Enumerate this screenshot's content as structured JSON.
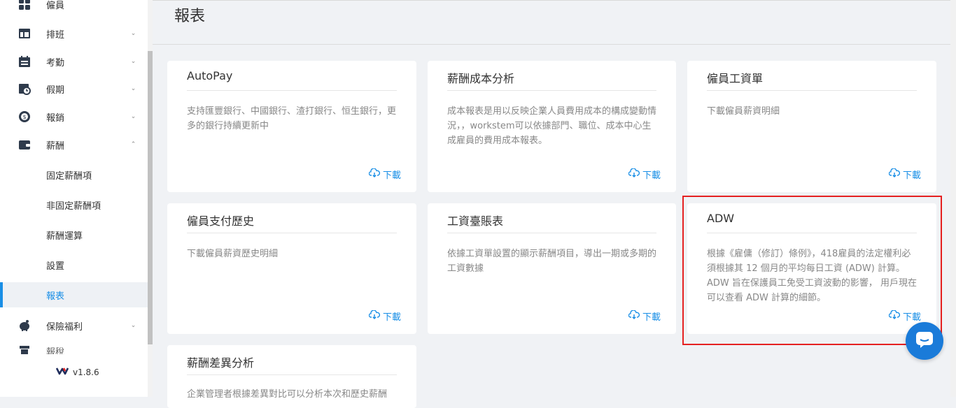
{
  "sidebar": {
    "items": [
      {
        "label": "僱員",
        "icon": "grid-icon",
        "chevron": ""
      },
      {
        "label": "排班",
        "icon": "layout-icon",
        "chevron": "⌄"
      },
      {
        "label": "考勤",
        "icon": "calendar-icon",
        "chevron": "⌄"
      },
      {
        "label": "假期",
        "icon": "calendar-clock-icon",
        "chevron": "⌄"
      },
      {
        "label": "報銷",
        "icon": "coin-icon",
        "chevron": "⌄"
      },
      {
        "label": "薪酬",
        "icon": "wallet-icon",
        "chevron": "⌃"
      }
    ],
    "sub_items": [
      {
        "label": "固定薪酬項"
      },
      {
        "label": "非固定薪酬項"
      },
      {
        "label": "薪酬運算"
      },
      {
        "label": "設置"
      },
      {
        "label": "報表"
      }
    ],
    "bottom_items": [
      {
        "label": "保險福利",
        "icon": "piggy-bank-icon",
        "chevron": "⌄"
      },
      {
        "label": "報稅",
        "icon": "tax-icon",
        "chevron": ""
      }
    ],
    "version": "v1.8.6"
  },
  "header": {
    "title": "報表"
  },
  "cards": [
    {
      "title": "AutoPay",
      "desc": "支持匯豐銀行、中國銀行、渣打銀行、恒生銀行，更多的銀行持續更新中",
      "download": "下載"
    },
    {
      "title": "薪酬成本分析",
      "desc": "成本報表是用以反映企業人員費用成本的構成變動情況，，workstem可以依據部門、職位、成本中心生成雇員的費用成本報表。",
      "download": "下載"
    },
    {
      "title": "僱員工資單",
      "desc": "下載僱員薪資明細",
      "download": "下載"
    },
    {
      "title": "僱員支付歷史",
      "desc": "下載僱員薪資歷史明細",
      "download": "下載"
    },
    {
      "title": "工資臺賬表",
      "desc": "依據工資單設置的顯示薪酬項目，導出一期或多期的工資數據",
      "download": "下載"
    },
    {
      "title": "ADW",
      "desc": "根據《雇傭（修訂）條例》，418雇員的法定權利必須根據其 12 個月的平均每日工資 (ADW) 計算。ADW 旨在保護員工免受工資波動的影響， 用戶現在可以查看 ADW 計算的細節。",
      "download": "下載"
    },
    {
      "title": "薪酬差異分析",
      "desc": "企業管理者根據差異對比可以分析本次和歷史薪酬",
      "download": ""
    }
  ],
  "colors": {
    "accent": "#1a8fe6",
    "highlight": "#e52121",
    "chat": "#1a7bd9"
  }
}
